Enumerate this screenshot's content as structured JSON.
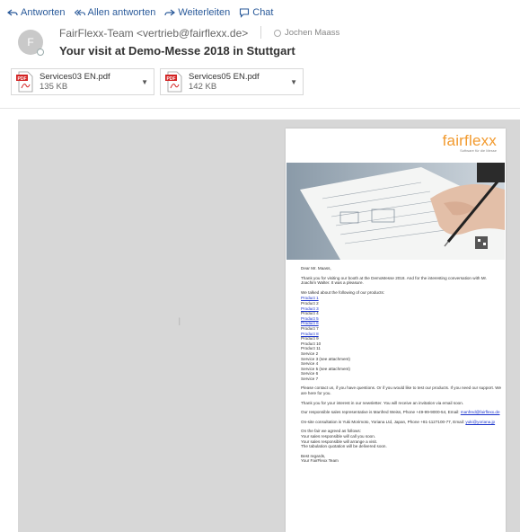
{
  "actions": [
    {
      "label": "Antworten",
      "icon": "reply-icon"
    },
    {
      "label": "Allen antworten",
      "icon": "reply-all-icon"
    },
    {
      "label": "Weiterleiten",
      "icon": "forward-icon"
    },
    {
      "label": "Chat",
      "icon": "chat-icon"
    }
  ],
  "header": {
    "avatar_initial": "F",
    "from": "FairFlexx-Team <vertrieb@fairflexx.de>",
    "recipient": "Jochen Maass",
    "subject": "Your visit at Demo-Messe 2018 in Stuttgart"
  },
  "attachments": [
    {
      "name": "Services03 EN.pdf",
      "size": "135 KB"
    },
    {
      "name": "Services05 EN.pdf",
      "size": "142 KB"
    }
  ],
  "email_body": {
    "brand": "fairflexx",
    "brand_tagline": "Software für die Messe",
    "greeting": "Dear Mr. Maass,",
    "p1": "Thank you for visiting our booth at the DemoMesse 2018. And for the interesting conversation with Mr. Joachim Walter. It was a pleasure.",
    "p2": "We talked about the following of our products:",
    "products": [
      {
        "text": "Product 1",
        "link": true
      },
      {
        "text": "Product 2",
        "link": false
      },
      {
        "text": "Product 3",
        "link": true
      },
      {
        "text": "Product 4",
        "link": false
      },
      {
        "text": "Product 5",
        "link": true
      },
      {
        "text": "Product 6",
        "link": true
      },
      {
        "text": "Product 7",
        "link": false
      },
      {
        "text": "Product 8",
        "link": true
      },
      {
        "text": "Product 9",
        "link": false
      },
      {
        "text": "Product 10",
        "link": false
      },
      {
        "text": "Product 11",
        "link": false
      },
      {
        "text": "Service 2",
        "link": false
      },
      {
        "text": "Service 3 (see attachment)",
        "link": false
      },
      {
        "text": "Service 4",
        "link": false
      },
      {
        "text": "Service 5 (see attachment)",
        "link": false
      },
      {
        "text": "Service 6",
        "link": false
      },
      {
        "text": "Service 7",
        "link": false
      }
    ],
    "p3": "Please contact us, if you have questions. Or if you would like to test our products. If you need our support. We are here for you.",
    "p4": "Thank you for your interest in our newsletter. You will receive an invitation via email soon.",
    "p5_text": "Our responsible sales representative is Manfred Weiss, Phone +49-99-9000-54, Email:",
    "p5_email": "manfred@fairflexx.de",
    "p6_text": "On-site consultation is Yuki Morimoto, Yoriana Ltd, Japan, Phone +81-1127100-77, Email:",
    "p6_email": "yuki@yoriana.jp",
    "p7": "On the fair we agreed as follows:",
    "agreements": [
      "Your sales responsible will call you soon.",
      "Your sales responsible will arrange a visit.",
      "The tabulation quotation will be delivered soon."
    ],
    "closing": "Best regards,",
    "signature": "Your FairFlexx Team"
  },
  "colors": {
    "link": "#2a5a9a",
    "brand": "#f29a2e",
    "viewer_bg": "#d7d7d7"
  }
}
